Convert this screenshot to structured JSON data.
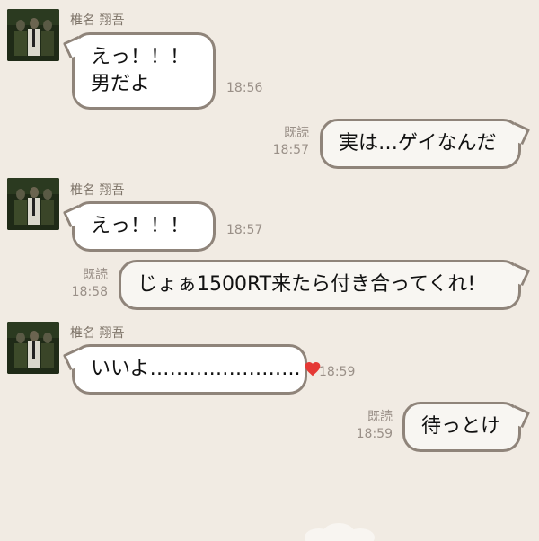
{
  "theme": {
    "background": "#f1ebe3",
    "bubble_border": "#8f847a",
    "heart": "#e53935"
  },
  "messages": [
    {
      "sender_name": "椎名 翔吾",
      "side": "left",
      "lines": [
        "えっ！！！",
        "男だよ"
      ],
      "time": "18:56"
    },
    {
      "side": "right",
      "read_label": "既読",
      "lines": [
        "実は…ゲイなんだ"
      ],
      "time": "18:57"
    },
    {
      "sender_name": "椎名 翔吾",
      "side": "left",
      "lines": [
        "えっ！！！"
      ],
      "time": "18:57"
    },
    {
      "side": "right",
      "read_label": "既読",
      "lines": [
        "じょぁ1500RT来たら付き合ってくれ!"
      ],
      "time": "18:58"
    },
    {
      "sender_name": "椎名 翔吾",
      "side": "left",
      "lines": [
        "いいよ………………….."
      ],
      "time": "18:59",
      "emoji": "heart-icon"
    },
    {
      "side": "right",
      "read_label": "既読",
      "lines": [
        "待っとけ"
      ],
      "time": "18:59"
    }
  ]
}
